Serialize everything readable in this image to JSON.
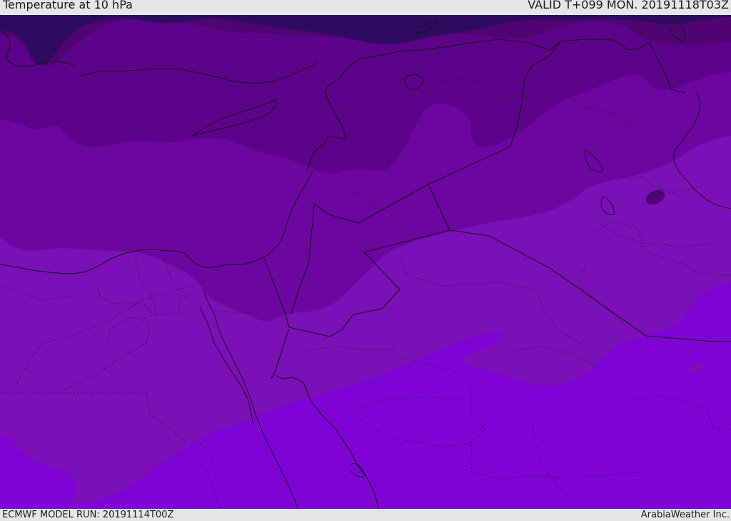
{
  "header": {
    "title": "Temperature at 10 hPa",
    "valid_time": "VALID T+099 MON. 20191118T03Z"
  },
  "footer": {
    "model_run": "ECMWF MODEL RUN: 20191114T00Z",
    "credit": "ArabiaWeather Inc."
  },
  "map": {
    "field": "temperature",
    "level": "10 hPa",
    "palette": {
      "band_1": "#2d0b5e",
      "band_2": "#4e0572",
      "band_3": "#5d0389",
      "band_4": "#6d06a0",
      "band_5": "#7a10b5",
      "band_6": "#7e04d6"
    },
    "border_color": "#141414"
  }
}
